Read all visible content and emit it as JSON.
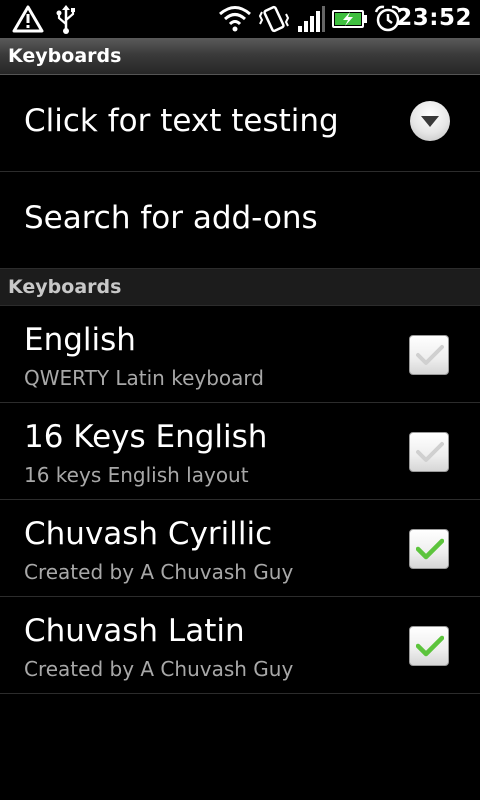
{
  "status_bar": {
    "time": "23:52",
    "icons": [
      "alert-triangle-icon",
      "usb-icon",
      "wifi-icon",
      "vibrate-icon",
      "signal-icon",
      "battery-charging-icon",
      "alarm-icon"
    ]
  },
  "title_bar": {
    "title": "Keyboards"
  },
  "items": [
    {
      "label": "Click for text testing",
      "icon": "chevron-down-icon"
    },
    {
      "label": "Search for add-ons"
    }
  ],
  "keyboards_section": {
    "header": "Keyboards",
    "keyboards": [
      {
        "name": "English",
        "description": "QWERTY Latin keyboard",
        "checked": false
      },
      {
        "name": "16 Keys English",
        "description": "16 keys English layout",
        "checked": false
      },
      {
        "name": "Chuvash Cyrillic",
        "description": "Created by A Chuvash Guy",
        "checked": true
      },
      {
        "name": "Chuvash Latin",
        "description": "Created by A Chuvash Guy",
        "checked": true
      }
    ]
  },
  "colors": {
    "background": "#000000",
    "check_green": "#5cc43c",
    "check_gray": "#d0d0d0",
    "secondary_text": "#a8a8a8"
  }
}
